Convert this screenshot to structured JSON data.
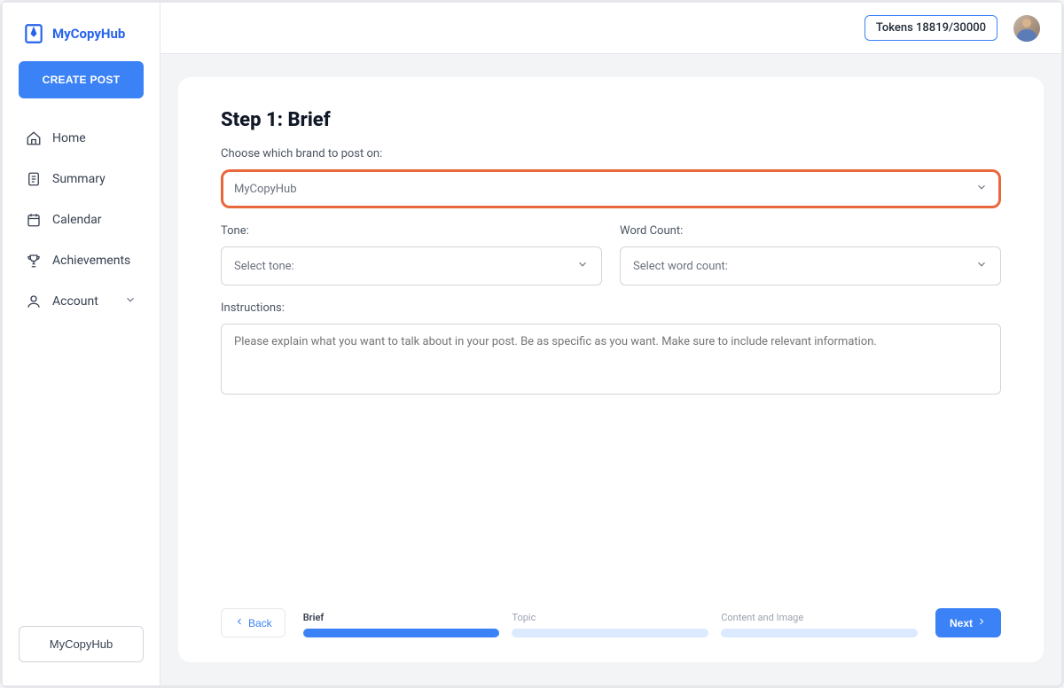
{
  "brand": "MyCopyHub",
  "header": {
    "tokens": "Tokens 18819/30000"
  },
  "sidebar": {
    "create_post": "CREATE POST",
    "items": [
      {
        "label": "Home",
        "icon": "home"
      },
      {
        "label": "Summary",
        "icon": "page"
      },
      {
        "label": "Calendar",
        "icon": "calendar"
      },
      {
        "label": "Achievements",
        "icon": "trophy"
      },
      {
        "label": "Account",
        "icon": "user",
        "expandable": true
      }
    ],
    "footer_button": "MyCopyHub"
  },
  "wizard": {
    "title": "Step 1: Brief",
    "brand_label": "Choose which brand to post on:",
    "brand_value": "MyCopyHub",
    "tone_label": "Tone:",
    "tone_value": "Select tone:",
    "wordcount_label": "Word Count:",
    "wordcount_value": "Select word count:",
    "instructions_label": "Instructions:",
    "instructions_placeholder": "Please explain what you want to talk about in your post. Be as specific as you want. Make sure to include relevant information.",
    "back": "Back",
    "next": "Next",
    "steps": [
      {
        "label": "Brief",
        "active": true
      },
      {
        "label": "Topic",
        "active": false
      },
      {
        "label": "Content and Image",
        "active": false
      }
    ]
  }
}
